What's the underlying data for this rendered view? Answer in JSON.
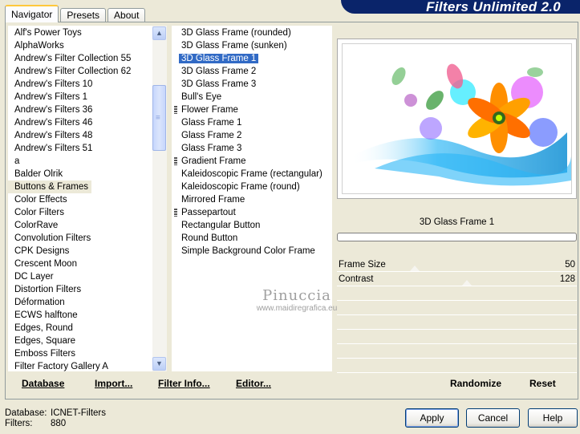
{
  "tabs": [
    {
      "label": "Navigator",
      "active": true
    },
    {
      "label": "Presets",
      "active": false
    },
    {
      "label": "About",
      "active": false
    }
  ],
  "title": "Filters Unlimited 2.0",
  "categories": [
    "Alf's Power Toys",
    "AlphaWorks",
    "Andrew's Filter Collection 55",
    "Andrew's Filter Collection 62",
    "Andrew's Filters 10",
    "Andrew's Filters 1",
    "Andrew's Filters 36",
    "Andrew's Filters 46",
    "Andrew's Filters 48",
    "Andrew's Filters 51",
    "a",
    "Balder Olrik",
    "Buttons & Frames",
    "Color Effects",
    "Color Filters",
    "ColorRave",
    "Convolution Filters",
    "CPK Designs",
    "Crescent Moon",
    "DC Layer",
    "Distortion Filters",
    "Déformation",
    "ECWS halftone",
    "Edges, Round",
    "Edges, Square",
    "Emboss Filters",
    "Filter Factory Gallery A"
  ],
  "selected_category": "Buttons & Frames",
  "filters": [
    {
      "label": "3D Glass Frame (rounded)",
      "group": false
    },
    {
      "label": "3D Glass Frame (sunken)",
      "group": false
    },
    {
      "label": "3D Glass Frame 1",
      "group": false
    },
    {
      "label": "3D Glass Frame 2",
      "group": false
    },
    {
      "label": "3D Glass Frame 3",
      "group": false
    },
    {
      "label": "Bull's Eye",
      "group": false
    },
    {
      "label": "Flower Frame",
      "group": true
    },
    {
      "label": "Glass Frame 1",
      "group": false
    },
    {
      "label": "Glass Frame 2",
      "group": false
    },
    {
      "label": "Glass Frame 3",
      "group": false
    },
    {
      "label": "Gradient Frame",
      "group": true
    },
    {
      "label": "Kaleidoscopic Frame (rectangular)",
      "group": false
    },
    {
      "label": "Kaleidoscopic Frame (round)",
      "group": false
    },
    {
      "label": "Mirrored Frame",
      "group": false
    },
    {
      "label": "Passepartout",
      "group": true
    },
    {
      "label": "Rectangular Button",
      "group": false
    },
    {
      "label": "Round Button",
      "group": false
    },
    {
      "label": "Simple Background Color Frame",
      "group": false
    }
  ],
  "selected_filter": "3D Glass Frame 1",
  "preview": {
    "filter_name": "3D Glass Frame 1"
  },
  "parameters": [
    {
      "label": "Frame Size",
      "value": "50",
      "level": 0.196
    },
    {
      "label": "Contrast",
      "value": "128",
      "level": 0.502
    }
  ],
  "watermark": {
    "line1": "Pinuccia",
    "line2": "www.maidiregrafica.eu"
  },
  "left_actions": {
    "database": "Database",
    "import": "Import...",
    "filter_info": "Filter Info...",
    "editor": "Editor..."
  },
  "right_actions": {
    "randomize": "Randomize",
    "reset": "Reset"
  },
  "status": {
    "database_label": "Database:",
    "database_value": "ICNET-Filters",
    "filters_label": "Filters:",
    "filters_value": "880"
  },
  "buttons": {
    "apply": "Apply",
    "cancel": "Cancel",
    "help": "Help"
  }
}
